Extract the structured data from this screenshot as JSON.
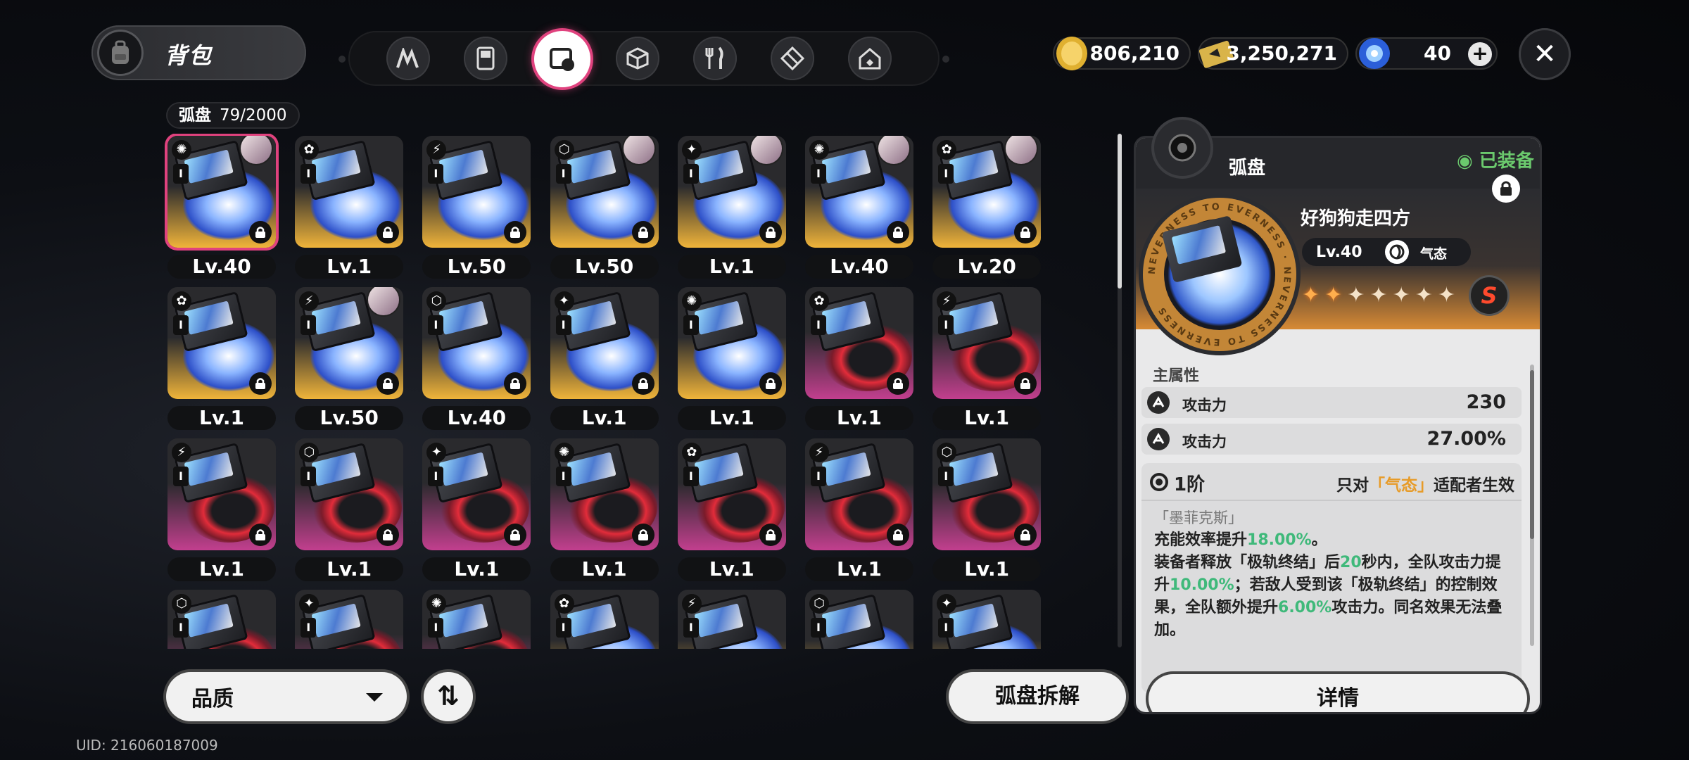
{
  "header": {
    "title": "背包",
    "tabs": [
      {
        "name": "tab-nethack"
      },
      {
        "name": "tab-gameboy"
      },
      {
        "name": "tab-disc",
        "active": true
      },
      {
        "name": "tab-box"
      },
      {
        "name": "tab-food"
      },
      {
        "name": "tab-cube"
      },
      {
        "name": "tab-house"
      }
    ],
    "currencies": [
      {
        "name": "gold-coin",
        "value": "806,210"
      },
      {
        "name": "ticket",
        "value": "3,250,271"
      },
      {
        "name": "energy-orb",
        "value": "40"
      }
    ],
    "close_icon": "close-icon"
  },
  "inventory": {
    "category": "弧盘",
    "count": "79/2000",
    "rows": [
      [
        "Lv.40",
        "Lv.1",
        "Lv.50",
        "Lv.50",
        "Lv.1",
        "Lv.40",
        "Lv.20"
      ],
      [
        "Lv.1",
        "Lv.50",
        "Lv.40",
        "Lv.1",
        "Lv.1",
        "Lv.1",
        "Lv.1"
      ],
      [
        "Lv.1",
        "Lv.1",
        "Lv.1",
        "Lv.1",
        "Lv.1",
        "Lv.1",
        "Lv.1"
      ],
      [
        "",
        "",
        "",
        "",
        "",
        "",
        ""
      ]
    ],
    "rank": "I"
  },
  "footer": {
    "sort_label": "品质",
    "dismantle_label": "弧盘拆解",
    "uid": "UID: 216060187009"
  },
  "detail": {
    "header": "弧盘",
    "equipped": "已装备",
    "disc_name": "好狗狗走四方",
    "ring_text": "NEVERNESS TO EVERNESS",
    "level": "Lv.40",
    "element": "气态",
    "stars_on": 2,
    "stars_total": 7,
    "section_title": "主属性",
    "stats": [
      {
        "label": "攻击力",
        "value": "230"
      },
      {
        "label": "攻击力",
        "value": "27.00%"
      }
    ],
    "tier": "1阶",
    "only_prefix": "只对",
    "only_elem": "「气态」",
    "only_suffix": "适配者生效",
    "set_name": "「墨菲克斯」",
    "desc1a": "充能效率提升",
    "desc1b": "18.00%",
    "desc1c": "。",
    "desc2a": "装备者释放「极轨终结」后",
    "desc2b": "20",
    "desc2c": "秒内，全队攻击力提升",
    "desc2d": "10.00%",
    "desc2e": "；若敌人受到该「极轨终结」的控制效果，全队额外提升",
    "desc2f": "6.00%",
    "desc2g": "攻击力。同名效果无法叠加。",
    "detail_button": "详情"
  },
  "colors": {
    "accent": "#e0427e",
    "equipped": "#6bc96d",
    "highlight": "#3fb97a",
    "element_orange": "#e79b28"
  }
}
